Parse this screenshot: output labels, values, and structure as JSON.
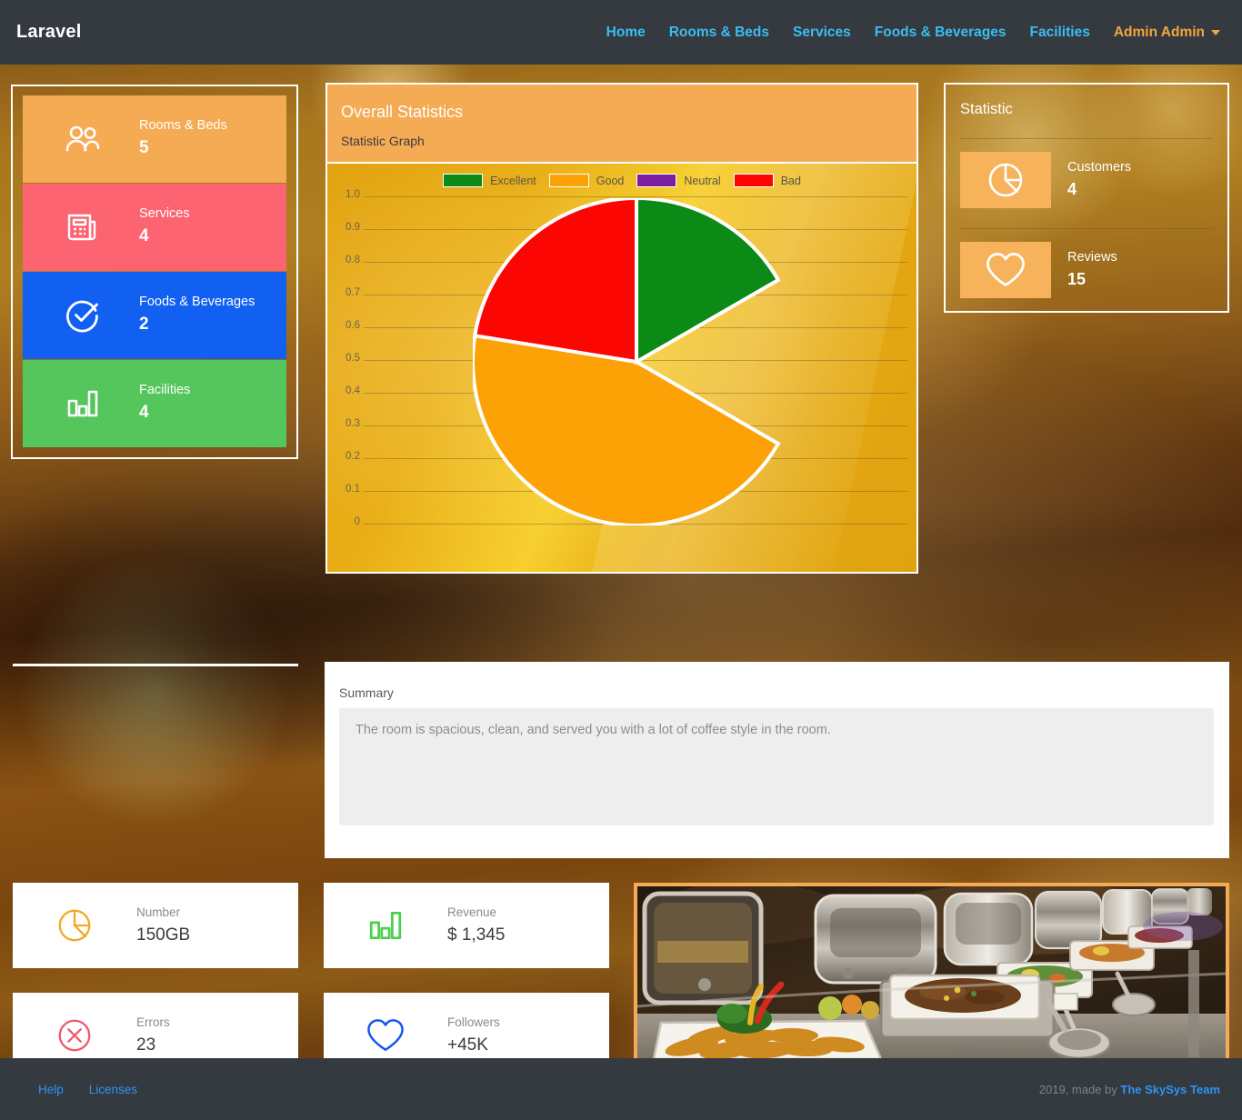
{
  "navbar": {
    "brand": "Laravel",
    "links": [
      {
        "label": "Home"
      },
      {
        "label": "Rooms & Beds"
      },
      {
        "label": "Services"
      },
      {
        "label": "Foods & Beverages"
      },
      {
        "label": "Facilities"
      }
    ],
    "user": "Admin Admin"
  },
  "quick_stats": [
    {
      "label": "Rooms & Beds",
      "value": "5",
      "color": "#f5aa54",
      "icon": "users-icon"
    },
    {
      "label": "Services",
      "value": "4",
      "color": "#fc6471",
      "icon": "newspaper-icon"
    },
    {
      "label": "Foods & Beverages",
      "value": "2",
      "color": "#1160f2",
      "icon": "check-circle-icon"
    },
    {
      "label": "Facilities",
      "value": "4",
      "color": "#55c65b",
      "icon": "bar-chart-icon"
    }
  ],
  "chart_card": {
    "title": "Overall Statistics",
    "subtitle": "Statistic Graph"
  },
  "chart_data": {
    "type": "pie",
    "title": "Overall Statistics",
    "subtitle": "Statistic Graph",
    "categories": [
      "Excellent",
      "Good",
      "Neutral",
      "Bad"
    ],
    "values": [
      16.7,
      61.1,
      0,
      22.2
    ],
    "colors": [
      "#0b8a15",
      "#fca106",
      "#7b1fa2",
      "#fb0603"
    ],
    "legend_position": "top",
    "grid": true,
    "ylabel": "",
    "xlabel": "",
    "ylim": [
      0,
      1.0
    ],
    "yticks": [
      "1.0",
      "0.9",
      "0.8",
      "0.7",
      "0.6",
      "0.5",
      "0.4",
      "0.3",
      "0.2",
      "0.1",
      "0"
    ],
    "slice_start_angles_deg": [
      0,
      60,
      280,
      280
    ],
    "note": "Neutral has zero share and is not drawn"
  },
  "statistic_panel": {
    "title": "Statistic",
    "rows": [
      {
        "label": "Customers",
        "value": "4",
        "icon": "pie-chart-icon"
      },
      {
        "label": "Reviews",
        "value": "15",
        "icon": "heart-icon"
      }
    ]
  },
  "summary": {
    "label": "Summary",
    "placeholder": "The room is spacious, clean, and served you with a lot of coffee style in the room.",
    "value": ""
  },
  "mini_cards": [
    {
      "label": "Number",
      "value": "150GB",
      "icon": "pie-chart-icon",
      "color": "#f5a623"
    },
    {
      "label": "Revenue",
      "value": "$ 1,345",
      "icon": "bar-chart-icon",
      "color": "#4ad04a"
    },
    {
      "label": "Errors",
      "value": "23",
      "icon": "error-circle-icon",
      "color": "#f4566a"
    },
    {
      "label": "Followers",
      "value": "+45K",
      "icon": "heart-icon",
      "color": "#1457f0"
    }
  ],
  "photo": {
    "alt": "buffet-food-photo"
  },
  "footer": {
    "links": [
      {
        "label": "Help"
      },
      {
        "label": "Licenses"
      }
    ],
    "credit_prefix": "2019, made by ",
    "credit_link": "The SkySys Team"
  }
}
